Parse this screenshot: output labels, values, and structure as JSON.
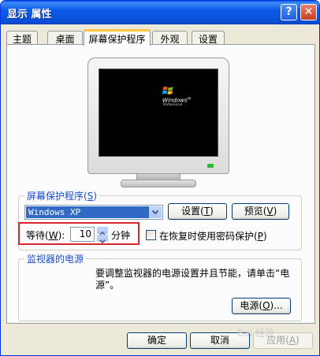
{
  "window": {
    "title": "显示 属性",
    "help_label": "?",
    "close_label": "✕"
  },
  "tabs": [
    {
      "label": "主题"
    },
    {
      "label": "桌面"
    },
    {
      "label": "屏幕保护程序",
      "active": true
    },
    {
      "label": "外观"
    },
    {
      "label": "设置"
    }
  ],
  "preview": {
    "logo_text": "Windows",
    "logo_sup": "xp",
    "edition": "Professional"
  },
  "screensaver_group": {
    "label": "屏幕保护程序",
    "label_hotkey": "S",
    "selected": "Windows XP",
    "settings_label": "设置",
    "settings_hotkey": "T",
    "preview_label": "预览",
    "preview_hotkey": "V",
    "wait_label": "等待",
    "wait_hotkey": "W",
    "wait_value": "10",
    "wait_unit": "分钟",
    "password_label": "在恢复时使用密码保护",
    "password_hotkey": "P",
    "password_checked": false
  },
  "power_group": {
    "label": "监视器的电源",
    "description_line1": "要调整监视器的电源设置并且节能，请单击“电",
    "description_line2": "源”。",
    "power_button_label": "电源",
    "power_hotkey": "O"
  },
  "footer": {
    "ok_label": "确定",
    "cancel_label": "取消",
    "apply_label": "应用",
    "apply_hotkey": "A"
  },
  "watermark": "Bai 经验",
  "colors": {
    "accent_title": "#0a58e8",
    "group_label": "#1d4acb",
    "highlight_box": "#d8262a",
    "selection": "#316ac5"
  }
}
